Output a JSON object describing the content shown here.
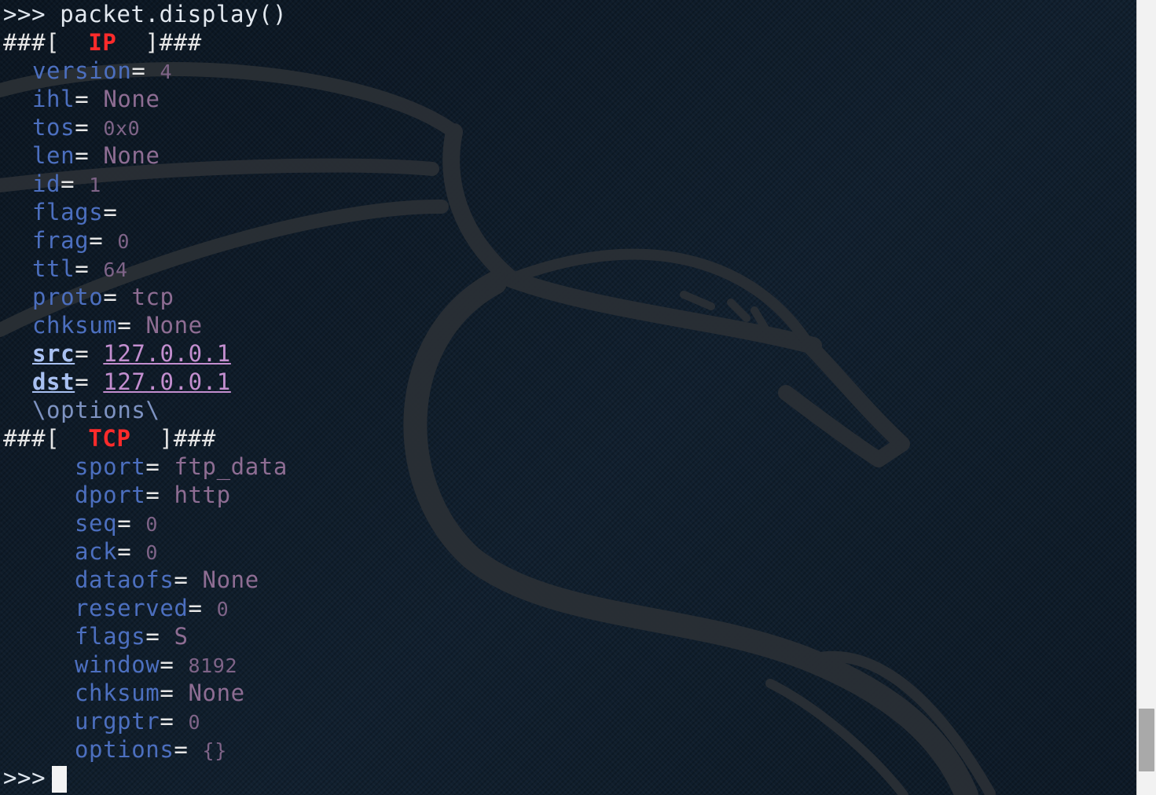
{
  "prompt": ">>>",
  "command": "packet.display()",
  "header_prefix": "###[",
  "header_suffix": "]###",
  "ip": {
    "layer": "IP",
    "fields": [
      {
        "name": "version",
        "value": "4",
        "kind": "num"
      },
      {
        "name": "ihl",
        "value": "None",
        "kind": "val"
      },
      {
        "name": "tos",
        "value": "0x0",
        "kind": "num"
      },
      {
        "name": "len",
        "value": "None",
        "kind": "val"
      },
      {
        "name": "id",
        "value": "1",
        "kind": "num"
      },
      {
        "name": "flags",
        "value": "",
        "kind": "val"
      },
      {
        "name": "frag",
        "value": "0",
        "kind": "num"
      },
      {
        "name": "ttl",
        "value": "64",
        "kind": "num"
      },
      {
        "name": "proto",
        "value": "tcp",
        "kind": "val"
      },
      {
        "name": "chksum",
        "value": "None",
        "kind": "val"
      },
      {
        "name": "src",
        "value": "127.0.0.1",
        "kind": "addr"
      },
      {
        "name": "dst",
        "value": "127.0.0.1",
        "kind": "addr"
      }
    ],
    "options": "\\options\\"
  },
  "tcp": {
    "layer": "TCP",
    "fields": [
      {
        "name": "sport",
        "value": "ftp_data",
        "kind": "val"
      },
      {
        "name": "dport",
        "value": "http",
        "kind": "val"
      },
      {
        "name": "seq",
        "value": "0",
        "kind": "num"
      },
      {
        "name": "ack",
        "value": "0",
        "kind": "num"
      },
      {
        "name": "dataofs",
        "value": "None",
        "kind": "val"
      },
      {
        "name": "reserved",
        "value": "0",
        "kind": "num"
      },
      {
        "name": "flags",
        "value": "S",
        "kind": "val"
      },
      {
        "name": "window",
        "value": "8192",
        "kind": "num"
      },
      {
        "name": "chksum",
        "value": "None",
        "kind": "val"
      },
      {
        "name": "urgptr",
        "value": "0",
        "kind": "num"
      },
      {
        "name": "options",
        "value": "{}",
        "kind": "num"
      }
    ]
  },
  "colors": {
    "background": "#0f1c29",
    "layer_name": "#ff2b2b",
    "field_name": "#4c6fbf",
    "field_value": "#8e6d93",
    "address": "#c38ecf"
  },
  "icons": {
    "background_watermark": "kali-dragon-icon",
    "cursor": "block-cursor-icon"
  }
}
